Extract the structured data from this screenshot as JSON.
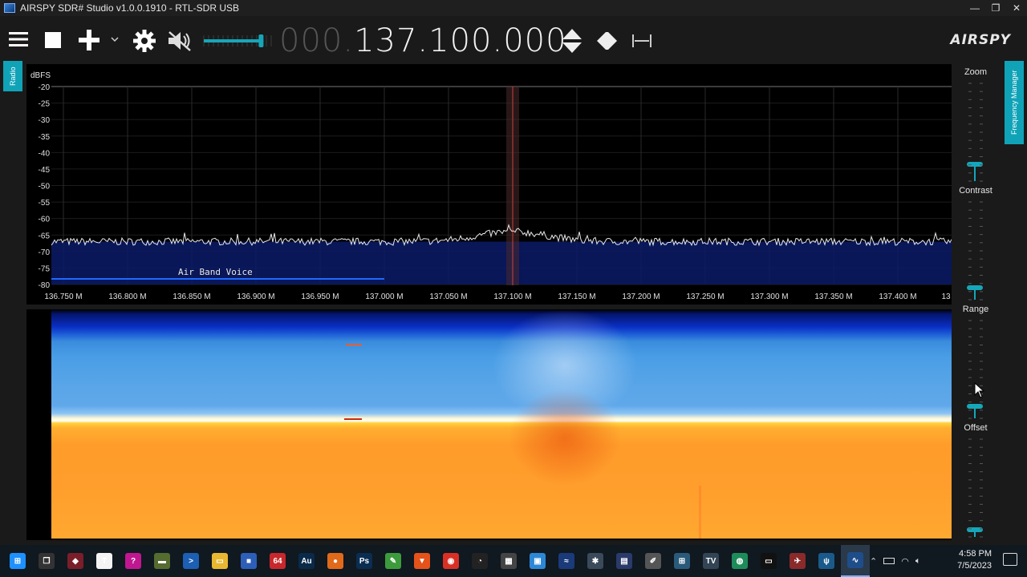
{
  "window": {
    "title": "AIRSPY SDR# Studio v1.0.0.1910 - RTL-SDR USB",
    "minimize": "—",
    "maximize": "❐",
    "close": "✕"
  },
  "toolbar": {
    "menu_icon": "hamburger-icon",
    "stop_icon": "stop-icon",
    "add_icon": "plus-icon",
    "add_dropdown_icon": "chevron-down-icon",
    "settings_icon": "gear-icon",
    "mute_icon": "speaker-muted-icon",
    "volume_level": 0.85,
    "frequency_dim": "000.",
    "frequency_lit": "137.100.000",
    "tune_icon": "up-down-arrows-icon",
    "skip_icon": "skip-to-start-icon",
    "span_icon": "span-width-icon",
    "logo": "AIRSPY"
  },
  "side_tabs": {
    "radio": "Radio",
    "frequency_manager": "Frequency Manager"
  },
  "spectrum": {
    "y_unit": "dBFS",
    "y_ticks": [
      "-20",
      "-25",
      "-30",
      "-35",
      "-40",
      "-45",
      "-50",
      "-55",
      "-60",
      "-65",
      "-70",
      "-75",
      "-80"
    ],
    "x_ticks": [
      "136.750 M",
      "136.800 M",
      "136.850 M",
      "136.900 M",
      "136.950 M",
      "137.000 M",
      "137.050 M",
      "137.100 M",
      "137.150 M",
      "137.200 M",
      "137.250 M",
      "137.300 M",
      "137.350 M",
      "137.400 M",
      "13"
    ],
    "band_label": "Air Band Voice",
    "noise_floor_dbfs": -67,
    "peak_dbfs": -64,
    "center_freq": "137.100 M"
  },
  "sliders": {
    "zoom": {
      "label": "Zoom",
      "level": 0.1
    },
    "contrast": {
      "label": "Contrast",
      "level": 0.05
    },
    "range": {
      "label": "Range",
      "level": 0.05
    },
    "offset": {
      "label": "Offset",
      "level": 0.0
    }
  },
  "taskbar": {
    "items": [
      {
        "name": "start-icon",
        "color": "#1e90ff",
        "glyph": "⊞"
      },
      {
        "name": "task-view-icon",
        "color": "#333",
        "glyph": "❐"
      },
      {
        "name": "app-red-icon",
        "color": "#7a1f2a",
        "glyph": "◆"
      },
      {
        "name": "app-text-icon",
        "color": "#f4f4f4",
        "glyph": "T"
      },
      {
        "name": "help-icon",
        "color": "#c01790",
        "glyph": "?"
      },
      {
        "name": "app-tank-icon",
        "color": "#556b2f",
        "glyph": "▬"
      },
      {
        "name": "powershell-icon",
        "color": "#1c5fb3",
        "glyph": ">"
      },
      {
        "name": "explorer-icon",
        "color": "#e8b830",
        "glyph": "▭"
      },
      {
        "name": "app-box-icon",
        "color": "#2d5fb8",
        "glyph": "■"
      },
      {
        "name": "app-64-icon",
        "color": "#c8282b",
        "glyph": "64"
      },
      {
        "name": "audition-icon",
        "color": "#0a2a4a",
        "glyph": "Au"
      },
      {
        "name": "app-orange-icon",
        "color": "#e06a1a",
        "glyph": "●"
      },
      {
        "name": "photoshop-icon",
        "color": "#0a2e52",
        "glyph": "Ps"
      },
      {
        "name": "notepad-icon",
        "color": "#3c9b3c",
        "glyph": "✎"
      },
      {
        "name": "brave-icon",
        "color": "#e5521a",
        "glyph": "▼"
      },
      {
        "name": "chrome-icon",
        "color": "#d93025",
        "glyph": "◉"
      },
      {
        "name": "app-speed-icon",
        "color": "#222",
        "glyph": "◔"
      },
      {
        "name": "app-brush-icon",
        "color": "#444",
        "glyph": "▦"
      },
      {
        "name": "app-chart-icon",
        "color": "#2d87d6",
        "glyph": "▣"
      },
      {
        "name": "sdr-icon",
        "color": "#1a3a7a",
        "glyph": "≈"
      },
      {
        "name": "app-globe-icon",
        "color": "#3a4a5a",
        "glyph": "✱"
      },
      {
        "name": "app-wave-icon",
        "color": "#2a3a6a",
        "glyph": "▤"
      },
      {
        "name": "app-pen-icon",
        "color": "#555",
        "glyph": "✐"
      },
      {
        "name": "app-grid-icon",
        "color": "#2a5a7a",
        "glyph": "⊞"
      },
      {
        "name": "sstv-icon",
        "color": "#334455",
        "glyph": "TV"
      },
      {
        "name": "app-earth-icon",
        "color": "#1e8c5a",
        "glyph": "◍"
      },
      {
        "name": "terminal-icon",
        "color": "#111",
        "glyph": "▭"
      },
      {
        "name": "app-satellite-icon",
        "color": "#8a2a2a",
        "glyph": "✈"
      },
      {
        "name": "antenna-icon",
        "color": "#1a5a8a",
        "glyph": "ψ"
      },
      {
        "name": "sdrsharp-icon",
        "color": "#1e4d8a",
        "glyph": "∿"
      }
    ],
    "tray": {
      "chevron_icon": "chevron-up-icon",
      "battery_icon": "battery-icon",
      "wifi_icon": "wifi-icon",
      "volume_icon": "volume-icon",
      "time": "4:58 PM",
      "date": "7/5/2023",
      "notification_icon": "notification-icon"
    }
  }
}
